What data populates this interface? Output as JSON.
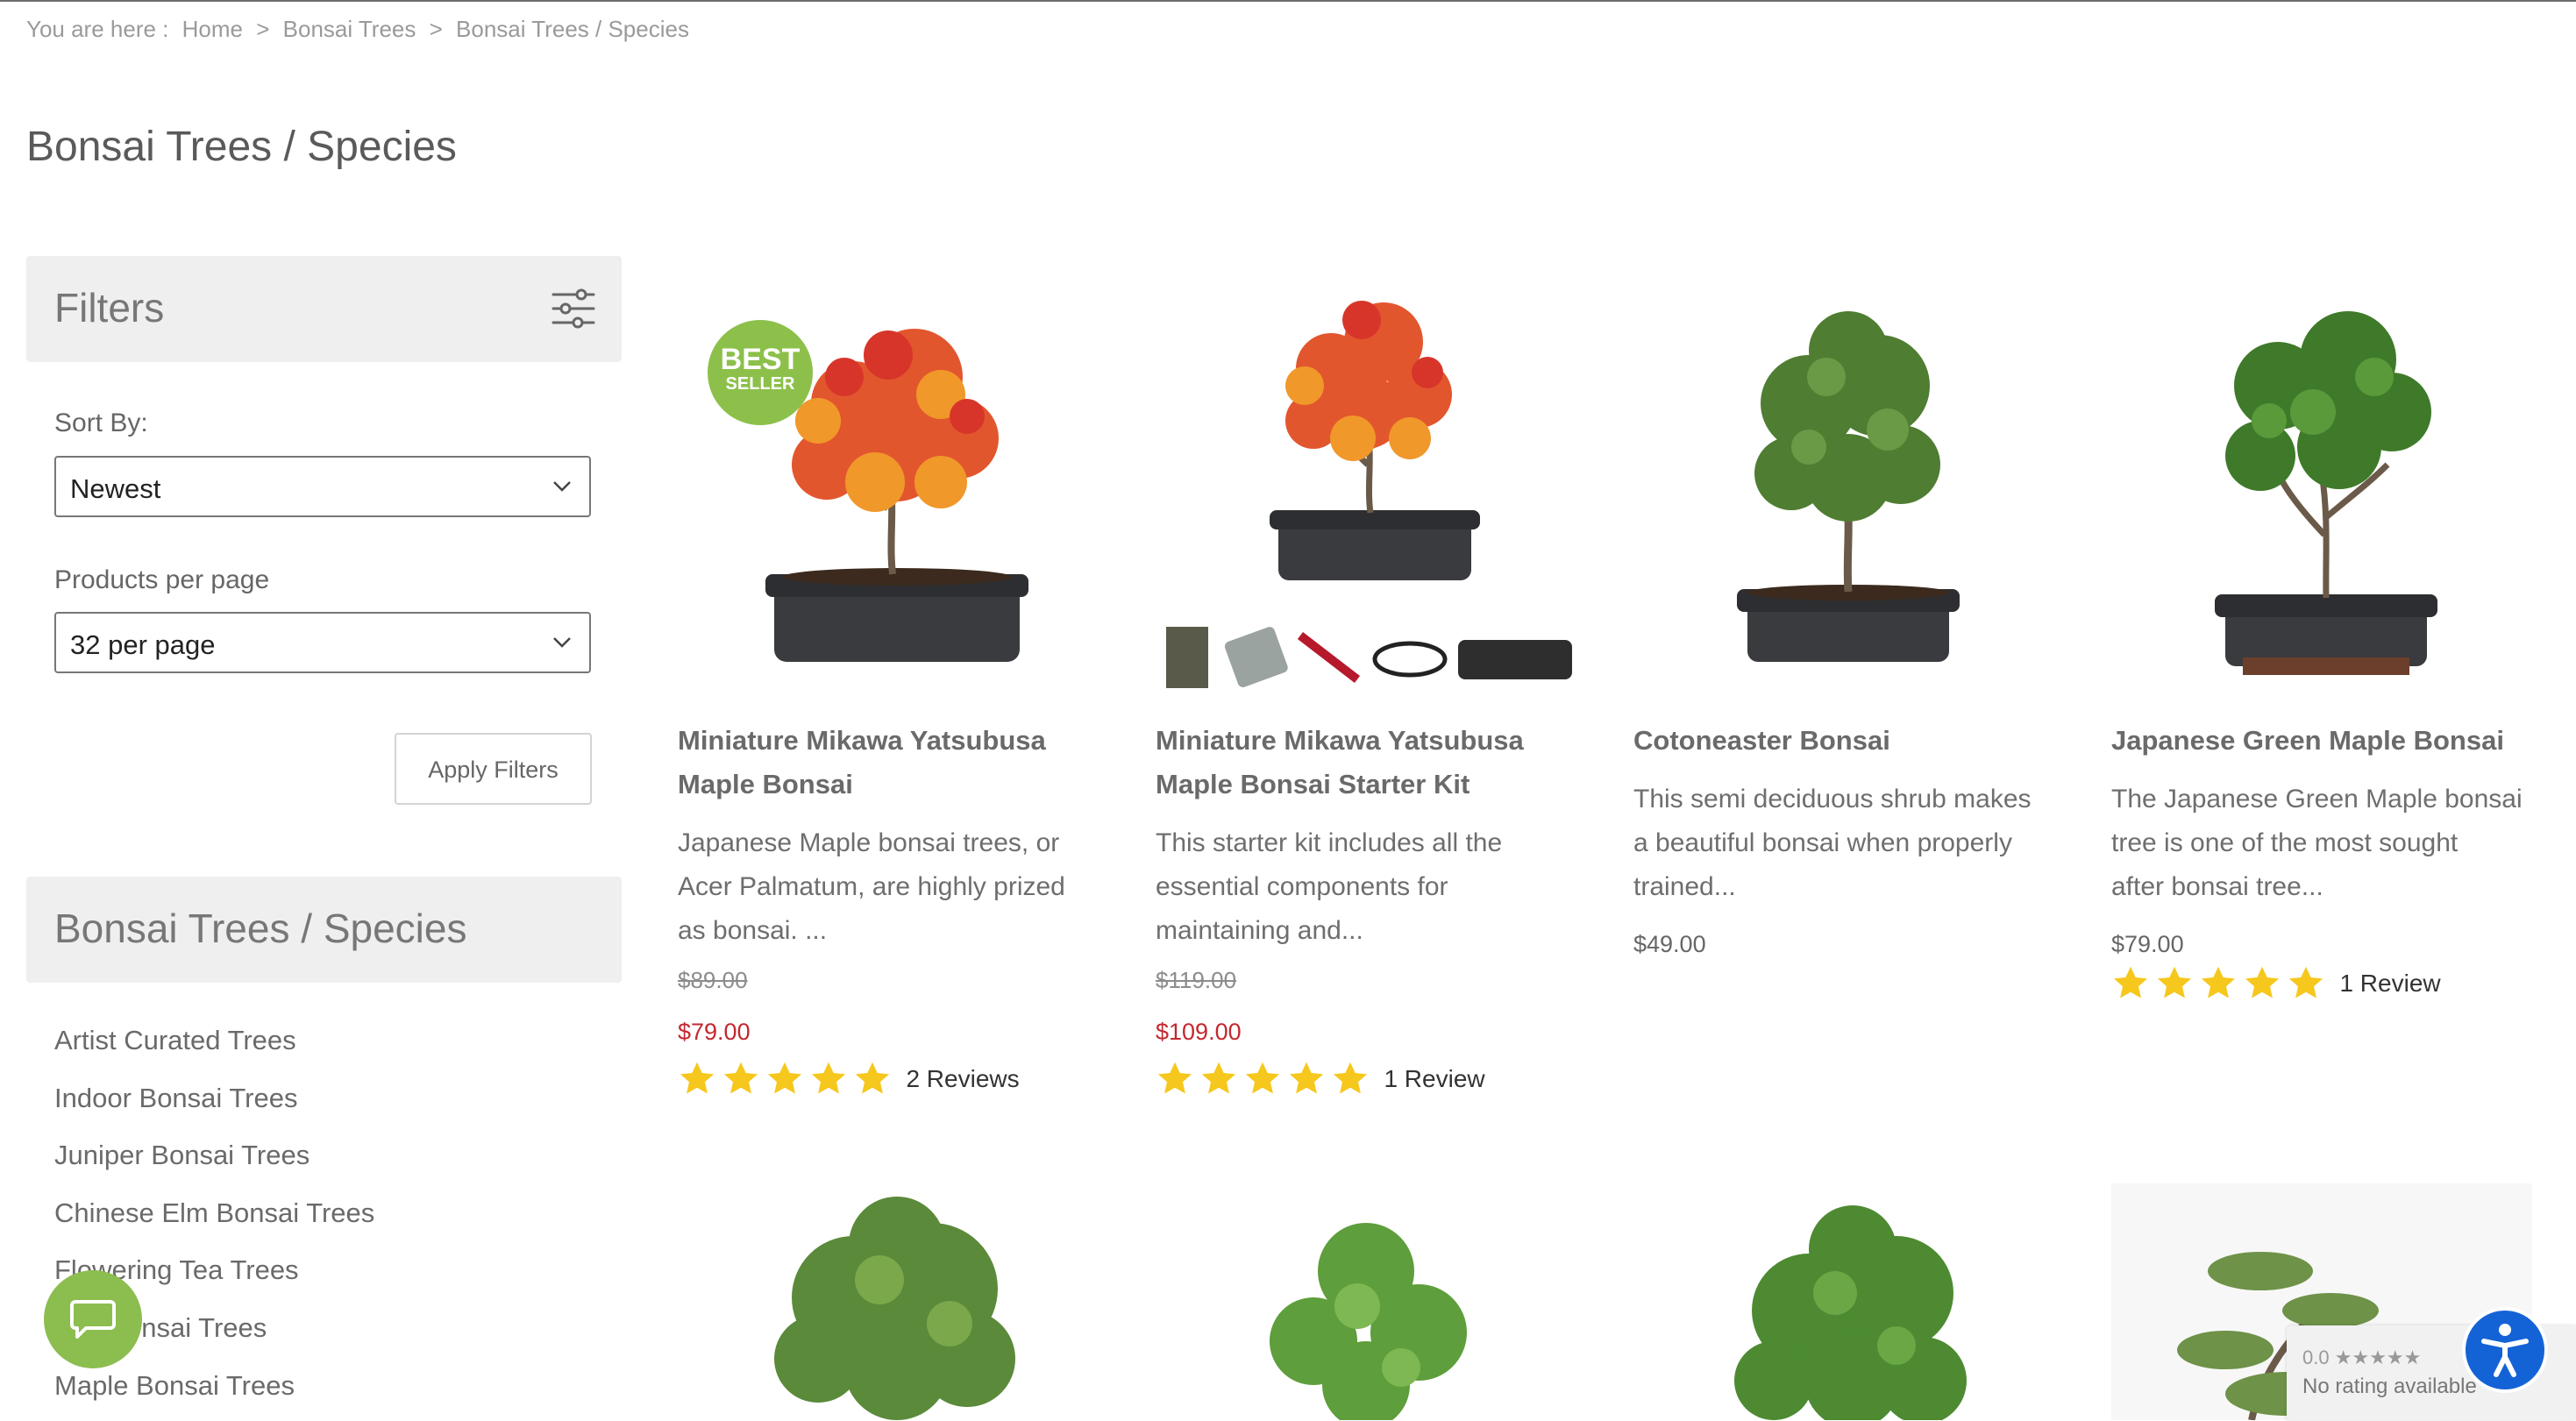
{
  "breadcrumb": {
    "prefix": "You are here :",
    "items": [
      "Home",
      "Bonsai Trees",
      "Bonsai Trees / Species"
    ],
    "separator": ">"
  },
  "page_title": "Bonsai Trees / Species",
  "filters": {
    "title": "Filters",
    "sort_label": "Sort By:",
    "sort_value": "Newest",
    "per_page_label": "Products per page",
    "per_page_value": "32 per page",
    "apply_label": "Apply Filters"
  },
  "category_panel": {
    "title": "Bonsai Trees / Species",
    "items": [
      "Artist Curated Trees",
      "Indoor Bonsai Trees",
      "Juniper Bonsai Trees",
      "Chinese Elm Bonsai Trees",
      "Flowering Tea Trees",
      "onsai Trees",
      "Maple Bonsai Trees"
    ]
  },
  "products": [
    {
      "name_line1": "Miniature Mikawa Yatsubusa",
      "name_line2": "Maple Bonsai",
      "desc_lines": [
        "Japanese Maple bonsai trees, or",
        "Acer Palmatum, are highly prized",
        "as bonsai. ..."
      ],
      "old_price": "$89.00",
      "price": "$79.00",
      "rating_stars": 5,
      "reviews": "2 Reviews",
      "badge_line1": "BEST",
      "badge_line2": "SELLER"
    },
    {
      "name_line1": "Miniature Mikawa Yatsubusa",
      "name_line2": "Maple Bonsai Starter Kit",
      "desc_lines": [
        "This starter kit includes all the",
        "essential components for",
        "maintaining and..."
      ],
      "old_price": "$119.00",
      "price": "$109.00",
      "rating_stars": 5,
      "reviews": "1 Review"
    },
    {
      "name_line1": "Cotoneaster Bonsai",
      "desc_lines": [
        "This semi deciduous shrub makes",
        "a beautiful bonsai when properly",
        "trained..."
      ],
      "price": "$49.00"
    },
    {
      "name_line1": "Japanese Green Maple Bonsai",
      "desc_lines": [
        "The Japanese Green Maple bonsai",
        "tree is one of the most sought",
        "after bonsai tree..."
      ],
      "price": "$79.00",
      "rating_stars": 5,
      "reviews": "1 Review"
    }
  ],
  "rating_widget": {
    "score": "0.0 ★★★★★",
    "text": "No rating available"
  },
  "colors": {
    "accent_green": "#8cc04a",
    "sale_red": "#c3282f",
    "star_yellow": "#f6c71c",
    "access_blue": "#1463d6"
  },
  "icons": [
    "sliders-icon",
    "chevron-down-icon",
    "chat-icon",
    "accessibility-icon",
    "star-icon"
  ]
}
